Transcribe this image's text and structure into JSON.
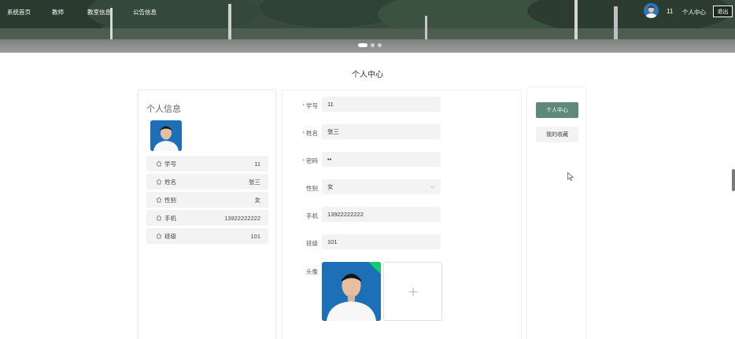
{
  "nav": {
    "items": [
      "系统首页",
      "教师",
      "教室信息",
      "公告信息"
    ]
  },
  "user": {
    "name": "11",
    "center_link": "个人中心",
    "logout_label": "退出"
  },
  "carousel": {
    "slides": 3,
    "active": 0
  },
  "page_title": "个人中心",
  "profile": {
    "title": "个人信息",
    "rows": [
      {
        "label": "学号",
        "value": "11"
      },
      {
        "label": "姓名",
        "value": "张三"
      },
      {
        "label": "性别",
        "value": "女"
      },
      {
        "label": "手机",
        "value": "13922222222"
      },
      {
        "label": "班级",
        "value": "101"
      }
    ]
  },
  "form": {
    "fields": [
      {
        "label": "学号",
        "required": true,
        "value": "11"
      },
      {
        "label": "姓名",
        "required": true,
        "value": "张三"
      },
      {
        "label": "密码",
        "required": true,
        "value": "••"
      },
      {
        "label": "性别",
        "required": false,
        "value": "女"
      },
      {
        "label": "手机",
        "required": false,
        "value": "13922222222"
      },
      {
        "label": "班级",
        "required": false,
        "value": "101"
      }
    ],
    "avatar_label": "头像"
  },
  "side_menu": {
    "items": [
      "个人中心",
      "我的收藏"
    ],
    "active": 0
  },
  "colors": {
    "accent": "#5e8979",
    "required": "#f56c6c",
    "upload_badge": "#13ce66"
  }
}
